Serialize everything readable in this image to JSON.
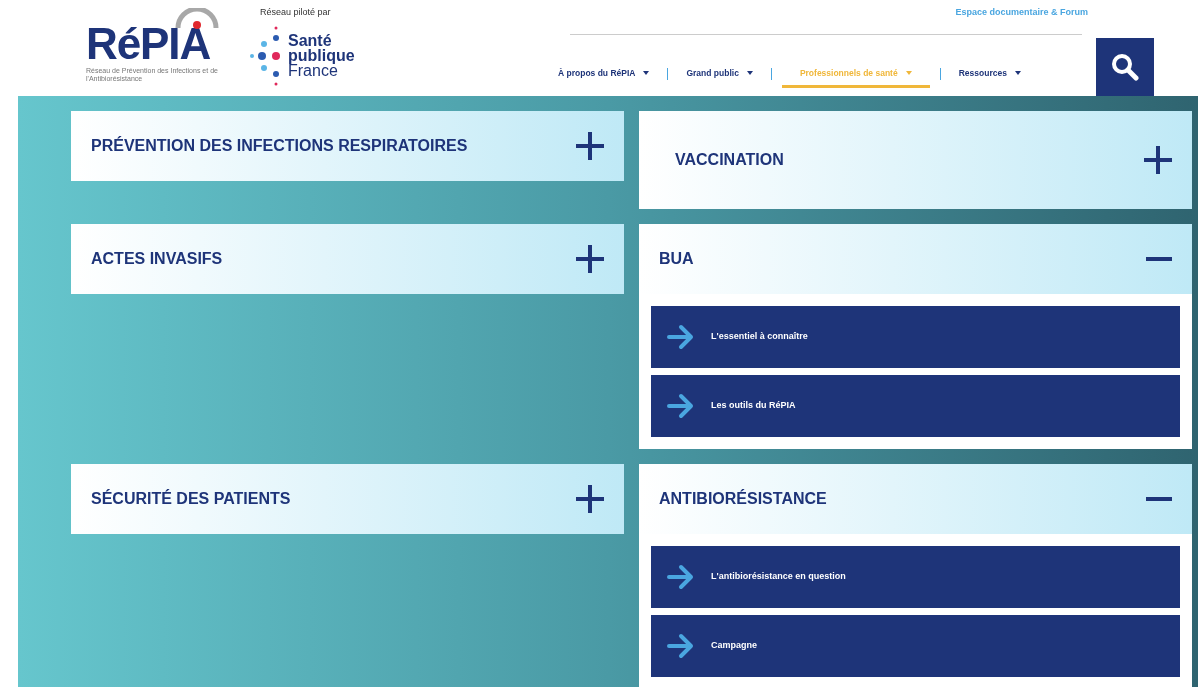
{
  "header": {
    "logo": {
      "name": "RéPIA",
      "tagline": "Réseau de Prévention des Infections et de l'Antibiorésistance"
    },
    "piloted_by": "Réseau piloté par",
    "partner": [
      "Santé",
      "publique",
      "France"
    ],
    "top_link": "Espace documentaire & Forum",
    "nav": [
      {
        "label": "À propos du RéPIA",
        "selected": false
      },
      {
        "label": "Grand public",
        "selected": false
      },
      {
        "label": "Professionnels de santé",
        "selected": true
      },
      {
        "label": "Ressources",
        "selected": false
      }
    ]
  },
  "rows": [
    [
      {
        "title": "PRÉVENTION DES INFECTIONS RESPIRATOIRES",
        "expanded": false
      },
      {
        "title": "VACCINATION",
        "expanded": false
      }
    ],
    [
      {
        "title": "ACTES INVASIFS",
        "expanded": false
      },
      {
        "title": "BUA",
        "expanded": true,
        "links": [
          "L'essentiel à connaître",
          "Les outils du RéPIA"
        ]
      }
    ],
    [
      {
        "title": "SÉCURITÉ DES PATIENTS",
        "expanded": false
      },
      {
        "title": "ANTIBIORÉSISTANCE",
        "expanded": true,
        "links": [
          "L'antibiorésistance en question",
          "Campagne"
        ]
      }
    ]
  ]
}
